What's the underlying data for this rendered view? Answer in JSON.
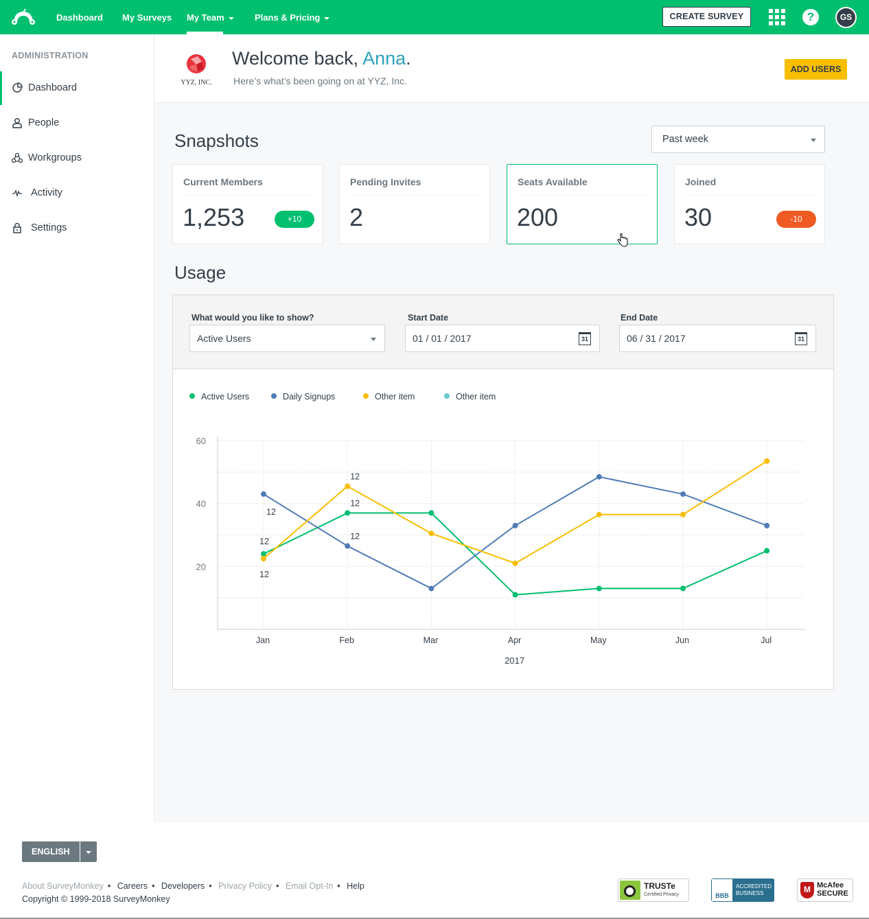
{
  "topnav": {
    "logo_icon": "surveymonkey-logo-icon",
    "items": [
      {
        "label": "Dashboard",
        "has_caret": false
      },
      {
        "label": "My Surveys",
        "has_caret": false
      },
      {
        "label": "My Team",
        "has_caret": true,
        "active": true
      },
      {
        "label": "Plans & Pricing",
        "has_caret": true
      }
    ],
    "create_survey_label": "CREATE SURVEY",
    "apps_icon": "grid-icon",
    "help_icon": "help-icon",
    "help_glyph": "?",
    "avatar_initials": "GS",
    "brand_color": "#00bf6f"
  },
  "sidebar": {
    "heading": "ADMINISTRATION",
    "items": [
      {
        "label": "Dashboard",
        "icon": "pie-chart-icon",
        "active": true
      },
      {
        "label": "People",
        "icon": "person-icon"
      },
      {
        "label": "Workgroups",
        "icon": "workgroups-icon"
      },
      {
        "label": "Activity",
        "icon": "activity-pulse-icon"
      },
      {
        "label": "Settings",
        "icon": "lock-icon"
      }
    ]
  },
  "welcome": {
    "company_logo_text": "YYZ, INC.",
    "greeting": "Welcome back, ",
    "name": "Anna",
    "period": ".",
    "subtitle": "Here’s what’s been going on at YYZ, Inc.",
    "add_users_label": "ADD USERS"
  },
  "snapshots": {
    "title": "Snapshots",
    "period_select": "Past week",
    "cards": [
      {
        "label": "Current Members",
        "value": "1,253",
        "badge": "+10",
        "badge_color": "#00bf6f"
      },
      {
        "label": "Pending Invites",
        "value": "2"
      },
      {
        "label": "Seats Available",
        "value": "200",
        "hovered": true
      },
      {
        "label": "Joined",
        "value": "30",
        "badge": "-10",
        "badge_color": "#f05b24"
      }
    ]
  },
  "usage": {
    "title": "Usage",
    "show_label": "What would you like to show?",
    "show_value": "Active Users",
    "start_label": "Start Date",
    "start_value": "01 / 01 / 2017",
    "end_label": "End Date",
    "end_value": "06 / 31 / 2017",
    "calendar_glyph": "31"
  },
  "chart_data": {
    "type": "line",
    "title": "",
    "xlabel": "2017",
    "ylabel": "",
    "categories": [
      "Jan",
      "Feb",
      "Mar",
      "Apr",
      "May",
      "Jun",
      "Jul"
    ],
    "ylim": [
      0,
      60
    ],
    "yticks": [
      20,
      40,
      60
    ],
    "grid": true,
    "legend_position": "top-left",
    "series": [
      {
        "name": "Active Users",
        "color": "#00bf6f",
        "values": [
          24,
          37,
          37,
          11,
          13,
          13,
          25
        ]
      },
      {
        "name": "Daily Signups",
        "color": "#507cb6",
        "values": [
          43,
          26.5,
          13,
          33,
          48.5,
          43,
          33
        ]
      },
      {
        "name": "Other item",
        "color": "#f9be00",
        "values": [
          22.5,
          45.5,
          30.5,
          21,
          36.5,
          36.5,
          53.5
        ]
      },
      {
        "name": "Other item",
        "color": "#6bc8cd",
        "values": []
      }
    ],
    "annotations": [
      {
        "series": 1,
        "index": 0,
        "text": "12",
        "pos": "below-right"
      },
      {
        "series": 0,
        "index": 0,
        "text": "12",
        "pos": "above"
      },
      {
        "series": 2,
        "index": 0,
        "text": "12",
        "pos": "below"
      },
      {
        "series": 2,
        "index": 1,
        "text": "12",
        "pos": "above-right"
      },
      {
        "series": 0,
        "index": 1,
        "text": "12",
        "pos": "above-right"
      },
      {
        "series": 1,
        "index": 1,
        "text": "12",
        "pos": "above-right"
      }
    ]
  },
  "footer": {
    "language": "ENGLISH",
    "links": [
      {
        "label": "About SurveyMonkey",
        "muted": true
      },
      {
        "label": "Careers",
        "muted": false
      },
      {
        "label": "Developers",
        "muted": false
      },
      {
        "label": "Privacy Policy",
        "muted": true
      },
      {
        "label": "Email Opt-In",
        "muted": true
      },
      {
        "label": "Help",
        "muted": false
      }
    ],
    "copyright": "Copyright © 1999-2018 SurveyMonkey",
    "seals": [
      {
        "name": "truste-seal",
        "title": "TRUSTe",
        "sub": "Certified Privacy"
      },
      {
        "name": "bbb-seal",
        "title": "ACCREDITED",
        "sub": "BUSINESS"
      },
      {
        "name": "mcafee-seal",
        "title": "McAfee",
        "sub": "SECURE"
      }
    ]
  }
}
